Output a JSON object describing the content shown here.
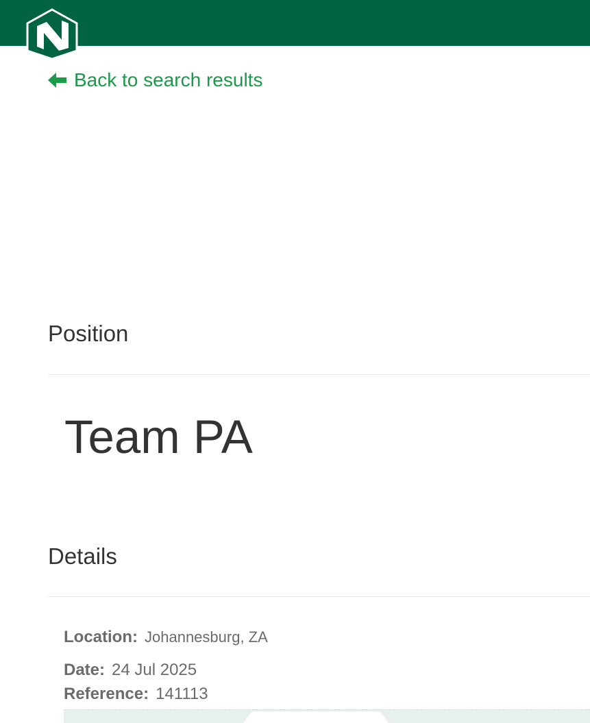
{
  "header": {
    "brand_color": "#006341",
    "logo_icon": "nedbank-n-logo"
  },
  "back_link": {
    "label": "Back to search results",
    "icon": "arrow-left-icon",
    "color": "#1b9a4a"
  },
  "position_section": {
    "heading": "Position",
    "title": "Team PA"
  },
  "details_section": {
    "heading": "Details",
    "location": {
      "label": "Location:",
      "value": "Johannesburg, ZA"
    },
    "date": {
      "label": "Date:",
      "value": "24 Jul 2025"
    },
    "reference": {
      "label": "Reference:",
      "value": "141113"
    }
  }
}
